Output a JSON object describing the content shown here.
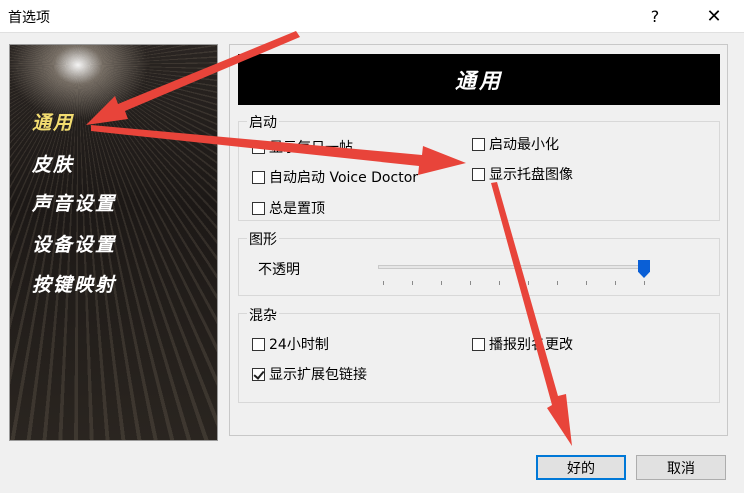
{
  "window": {
    "title": "首选项",
    "help_glyph": "?",
    "close_glyph": "✕"
  },
  "sidebar": {
    "items": [
      {
        "label": "通用",
        "active": true
      },
      {
        "label": "皮肤",
        "active": false
      },
      {
        "label": "声音设置",
        "active": false
      },
      {
        "label": "设备设置",
        "active": false
      },
      {
        "label": "按键映射",
        "active": false
      }
    ]
  },
  "main": {
    "header": "通用",
    "startup": {
      "title": "启动",
      "show_daily_tip": {
        "label": "显示每日一帖",
        "checked": false
      },
      "auto_start": {
        "label": "自动启动 Voice Doctor",
        "checked": false
      },
      "always_on_top": {
        "label": "总是置顶",
        "checked": false
      },
      "start_minimized": {
        "label": "启动最小化",
        "checked": false
      },
      "show_tray_icon": {
        "label": "显示托盘图像",
        "checked": false
      }
    },
    "graphics": {
      "title": "图形",
      "opacity_label": "不透明",
      "opacity_value_percent": 100
    },
    "misc": {
      "title": "混杂",
      "clock_24h": {
        "label": "24小时制",
        "checked": false
      },
      "announce_alias_change": {
        "label": "播报别名更改",
        "checked": false
      },
      "show_ext_link": {
        "label": "显示扩展包链接",
        "checked": true
      }
    }
  },
  "buttons": {
    "ok": "好的",
    "cancel": "取消"
  },
  "colors": {
    "annotation_arrow": "#e8443a",
    "active_nav": "#f2dc70",
    "default_button_border": "#0078d7"
  }
}
